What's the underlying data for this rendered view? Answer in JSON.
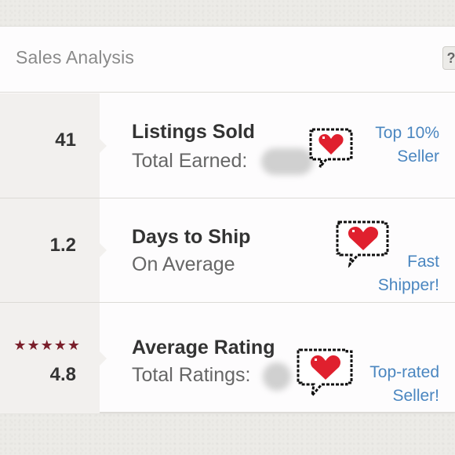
{
  "header": {
    "title": "Sales Analysis",
    "help_label": "?"
  },
  "rows": [
    {
      "metric": "41",
      "label": "Listings Sold",
      "sub_label": "Total Earned:",
      "badge_line1": "Top 10%",
      "badge_line2": "Seller"
    },
    {
      "metric": "1.2",
      "label": "Days to Ship",
      "sub_label": "On Average",
      "badge_line1": "Fast",
      "badge_line2": "Shipper!"
    },
    {
      "metric": "4.8",
      "stars": "★★★★★",
      "star_rating": 5,
      "label": "Average Rating",
      "sub_label": "Total Ratings:",
      "badge_line1": "Top-rated",
      "badge_line2": "Seller!"
    }
  ],
  "colors": {
    "accent_link": "#4a86c0",
    "star": "#7a1f2b",
    "heart": "#e0202e"
  },
  "icons": {
    "heart": "pixel-heart-speech-bubble-icon"
  }
}
